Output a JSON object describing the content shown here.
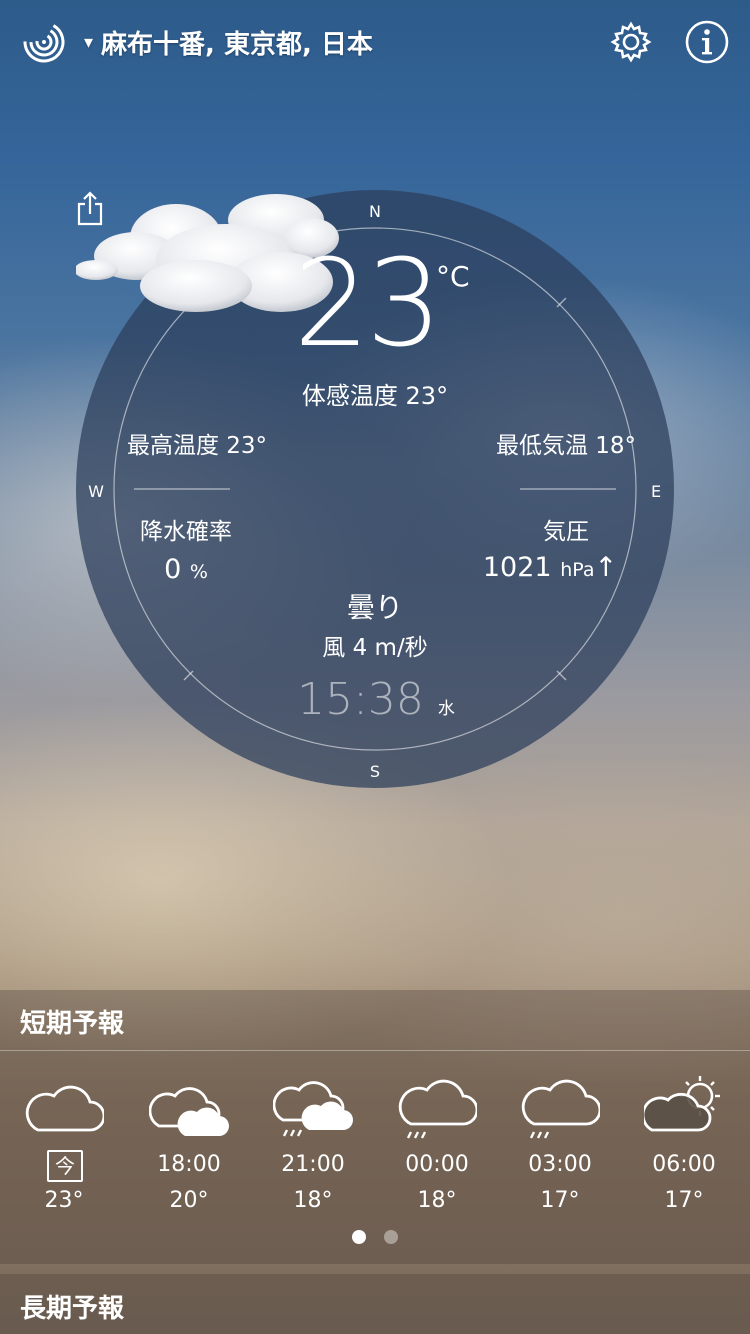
{
  "header": {
    "location": "麻布十番, 東京都, 日本",
    "caret": "▾"
  },
  "current": {
    "temperature": "23",
    "unit": "°C",
    "feels_like": "体感温度 23°",
    "high": "最高温度 23°",
    "low": "最低気温 18°",
    "precip_label": "降水確率",
    "precip_value": "0",
    "precip_unit": "%",
    "pressure_label": "気圧",
    "pressure_value": "1021",
    "pressure_unit": "hPa",
    "pressure_trend": "↑",
    "condition": "曇り",
    "wind": "風 4 m/秒",
    "time": "15:38",
    "weekday": "水"
  },
  "compass": {
    "north": "N",
    "south": "S",
    "west": "W",
    "east": "E"
  },
  "short_term": {
    "title": "短期予報",
    "items": [
      {
        "time": "今",
        "temp": "23°",
        "icon": "cloud-icon",
        "is_now": true
      },
      {
        "time": "18:00",
        "temp": "20°",
        "icon": "clouds-icon"
      },
      {
        "time": "21:00",
        "temp": "18°",
        "icon": "clouds-drizzle-icon"
      },
      {
        "time": "00:00",
        "temp": "18°",
        "icon": "cloud-drizzle-icon"
      },
      {
        "time": "03:00",
        "temp": "17°",
        "icon": "cloud-drizzle-icon"
      },
      {
        "time": "06:00",
        "temp": "17°",
        "icon": "partly-sunny-icon"
      }
    ],
    "page_count": 2,
    "active_page": 1
  },
  "long_term": {
    "title": "長期予報"
  },
  "colors": {
    "wind_marker": "#a81e2a",
    "dial_fill": "#2b3d5a"
  }
}
